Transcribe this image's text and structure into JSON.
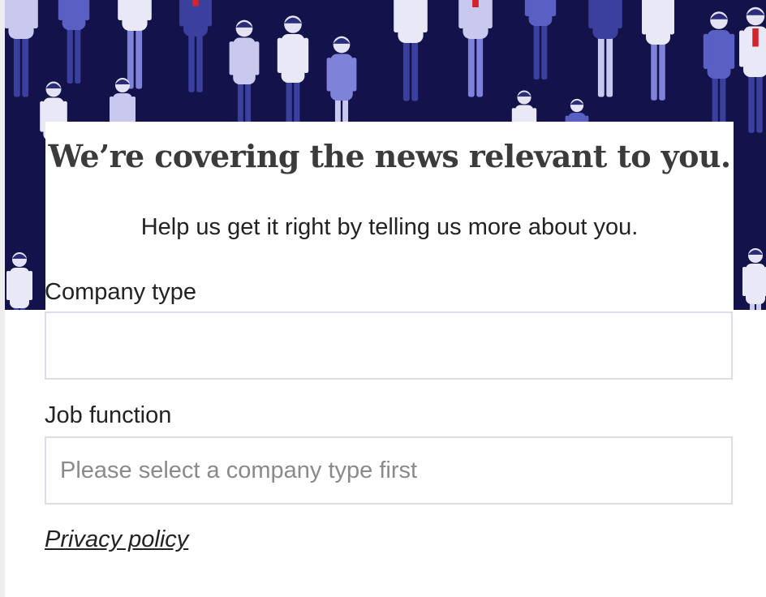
{
  "hero": {
    "headline": "We’re covering the news relevant to you.",
    "subline": "Help us get it right by telling us more about you."
  },
  "form": {
    "company_type": {
      "label": "Company type",
      "value": "",
      "placeholder": ""
    },
    "job_function": {
      "label": "Job function",
      "value": "",
      "placeholder": "Please select a company type first"
    },
    "privacy_link": "Privacy policy"
  },
  "colors": {
    "hero_background": "#13124a",
    "illustration_primary": "#5a5fc4",
    "illustration_light": "#c9c9ef",
    "accent_red": "#d5232b",
    "text": "#222222",
    "field_border": "#dcdcea"
  }
}
